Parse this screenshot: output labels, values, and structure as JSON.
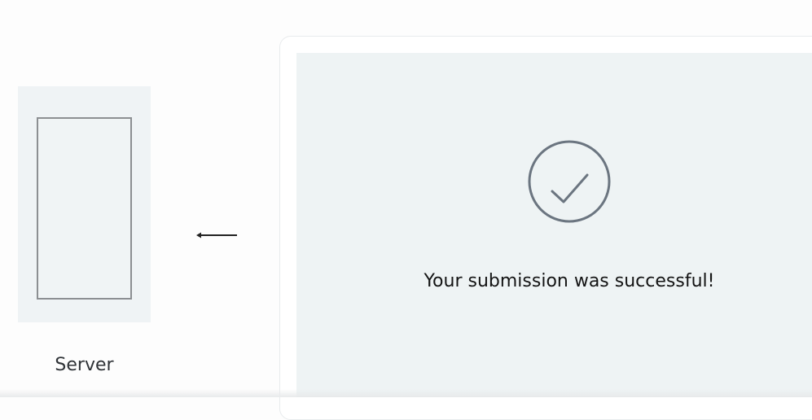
{
  "server": {
    "label": "Server"
  },
  "confirmation": {
    "message": "Your submission was successful!",
    "icon": "check-circle-icon"
  },
  "arrow": {
    "direction": "left"
  },
  "colors": {
    "panel": "#eef3f4",
    "icon_stroke": "#6b7580",
    "text": "#141414"
  }
}
